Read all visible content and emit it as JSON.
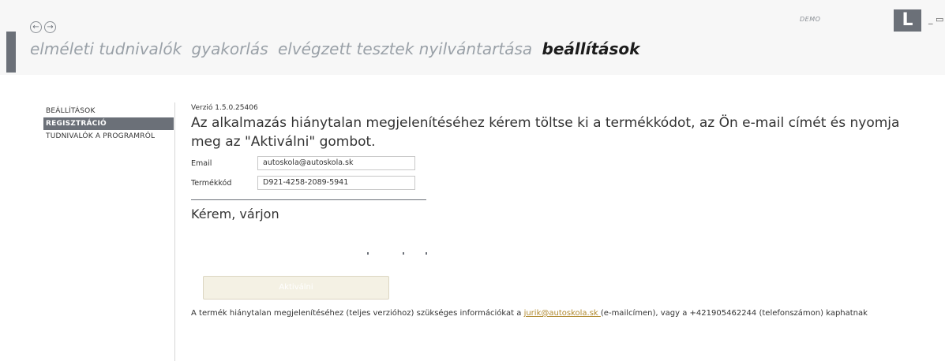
{
  "header": {
    "nav_items": [
      "elméleti tudnivalók",
      "gyakorlás",
      "elvégzett tesztek nyilvántartása"
    ],
    "active_item": "beállítások",
    "demo_label": "DEMO",
    "logo_letter": "L",
    "window_controls": "_ ▭ ×"
  },
  "sidebar": {
    "items": [
      "BEÁLLÍTÁSOK",
      "REGISZTRÁCIÓ",
      "TUDNIVALÓK A PROGRAMRÓL"
    ],
    "selected_index": 1
  },
  "content": {
    "version": "Verzió 1.5.0.25406",
    "headline": "Az alkalmazás hiánytalan  megjelenítéséhez kérem töltse  ki  a termékkódot, az Ön e-mail címét és nyomja meg az \"Aktiválni\" gombot.",
    "email_label": "Email",
    "email_value": "autoskola@autoskola.sk",
    "code_label": "Termékkód",
    "code_value": "D921-4258-2089-5941",
    "wait_text": "Kérem, várjon",
    "activate_label": "Aktiválni",
    "info_before": "A termék hiánytalan megjelenítéséhez (teljes verzióhoz) szükséges információkat a ",
    "info_email": "jurik@autoskola.sk ",
    "info_after": " (e-mailcímen), vagy a +421905462244 (telefonszámon) kaphatnak"
  },
  "colors": {
    "accent": "#6b7078",
    "nav_inactive": "#9aa1a8",
    "link": "#b0892f"
  }
}
